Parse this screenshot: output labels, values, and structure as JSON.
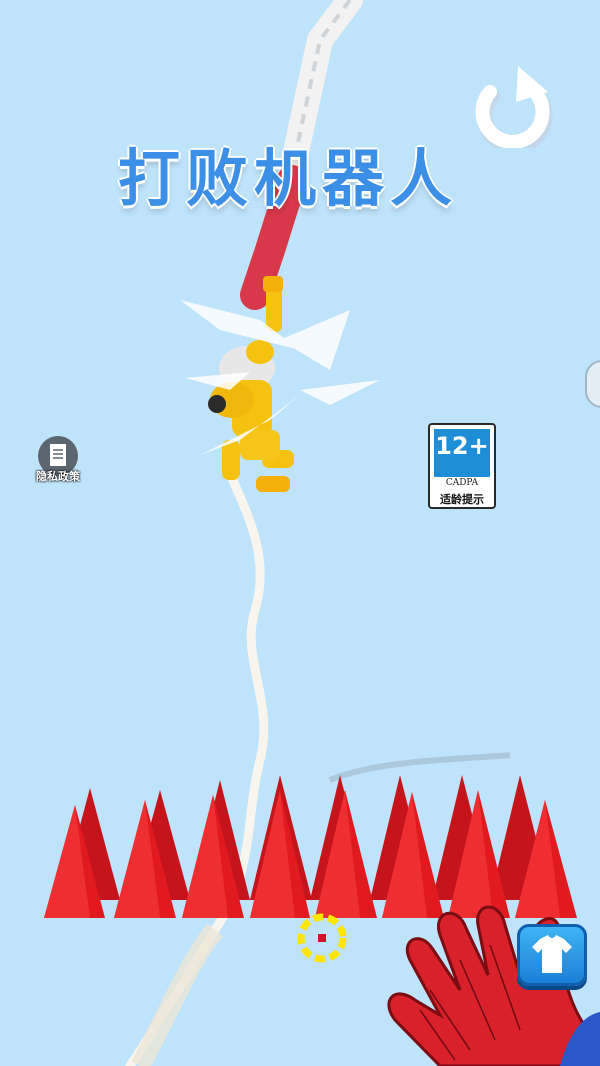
{
  "title": "打败机器人",
  "privacy": {
    "label": "隐私政策",
    "icon": "document-icon"
  },
  "age_rating": {
    "number": "12+",
    "org": "CADPA",
    "hint": "适龄提示",
    "color": "#1d8ed7"
  },
  "buttons": {
    "restart_icon": "restart-icon",
    "shop_icon": "shirt-icon"
  },
  "colors": {
    "sky": "#bfe3fb",
    "spikes": "#e01a1f",
    "robot": "#f5c20f",
    "title": "#3b8fe6",
    "rope": "#ffffff"
  }
}
